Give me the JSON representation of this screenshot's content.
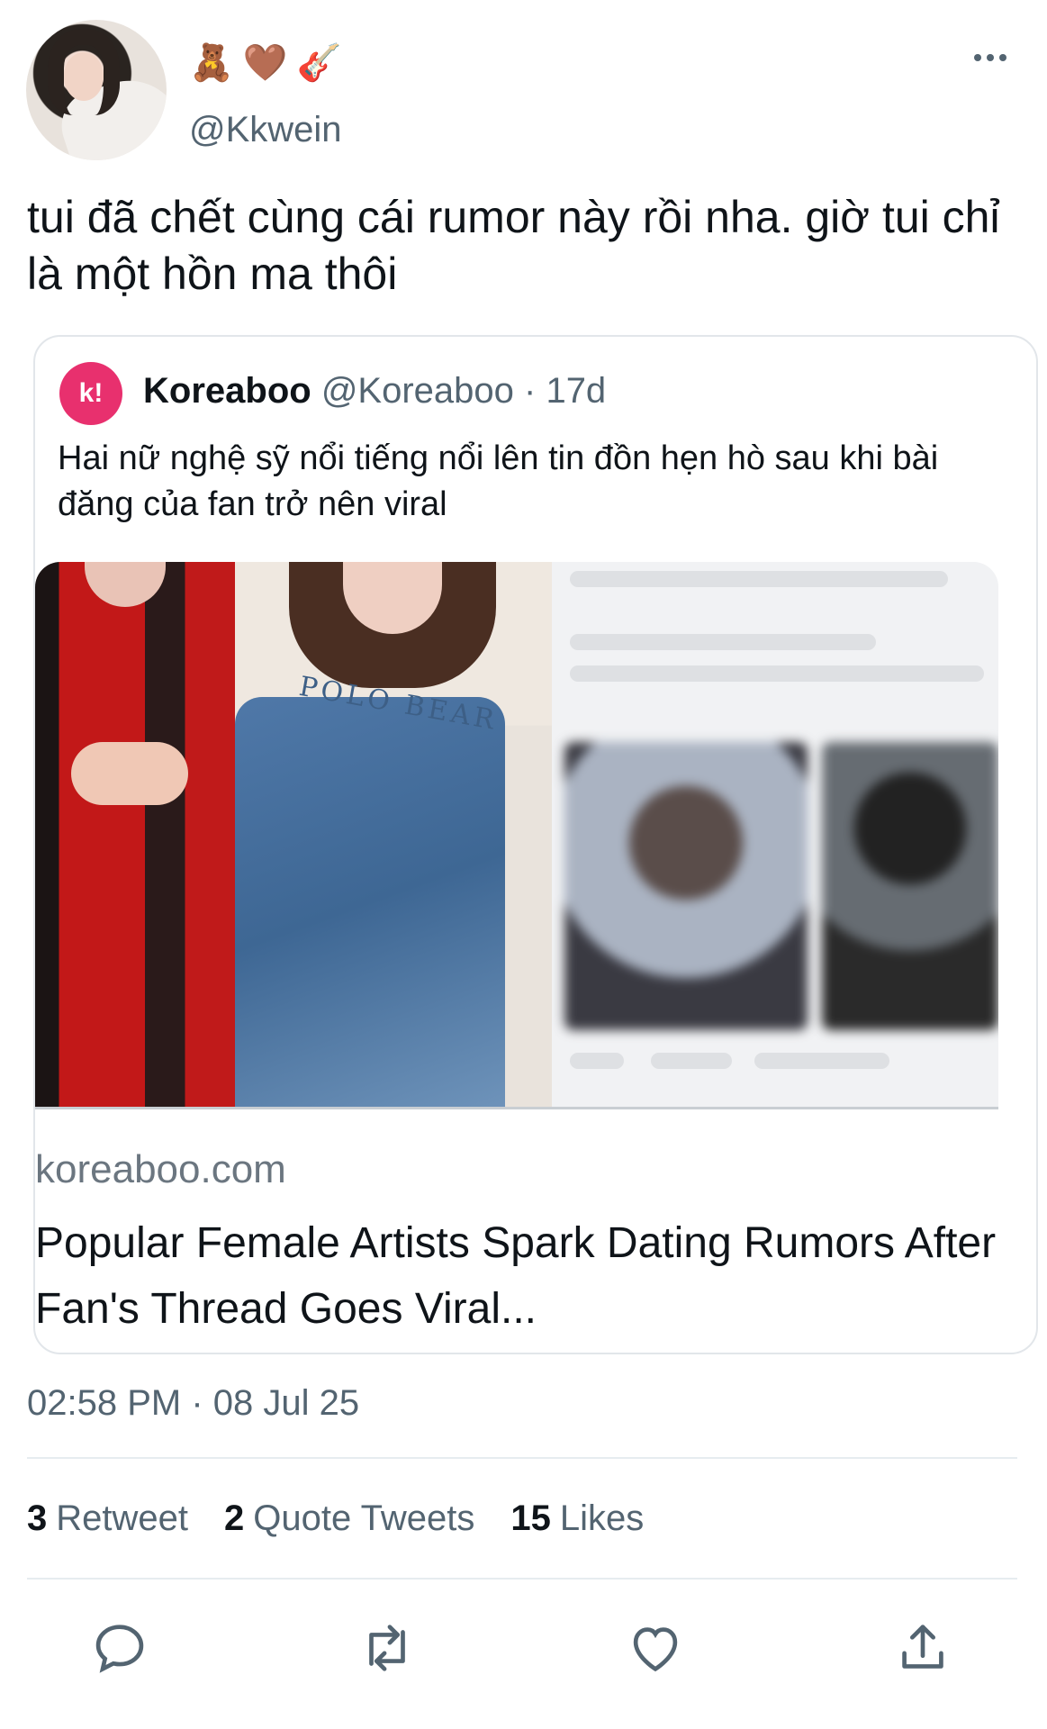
{
  "tweet": {
    "emojis": [
      "🧸",
      "🤎",
      "🎸"
    ],
    "handle": "@Kkwein",
    "text": "tui đã chết cùng cái rumor này rồi nha. giờ tui chỉ là một hồn ma thôi",
    "timestamp": "02:58 PM · 08 Jul 25"
  },
  "quote": {
    "logo_text": "k!",
    "name": "Koreaboo",
    "meta": "@Koreaboo · 17d",
    "text": "Hai nữ nghệ sỹ nổi tiếng nổi lên tin đồn hẹn hò sau khi bài đăng của fan trở nên viral",
    "image_shirt_text": "POLO BEAR",
    "card": {
      "domain": "koreaboo.com",
      "title": "Popular Female Artists Spark Dating Rumors After Fan's Thread Goes Viral..."
    }
  },
  "stats": [
    {
      "count": "3",
      "label": "Retweet"
    },
    {
      "count": "2",
      "label": "Quote Tweets"
    },
    {
      "count": "15",
      "label": "Likes"
    }
  ],
  "actions": [
    "reply-icon",
    "retweet-icon",
    "like-icon",
    "share-icon"
  ],
  "colors": {
    "brand": "#e8306e",
    "secondary_text": "#536471",
    "border": "#e2e6ea"
  }
}
